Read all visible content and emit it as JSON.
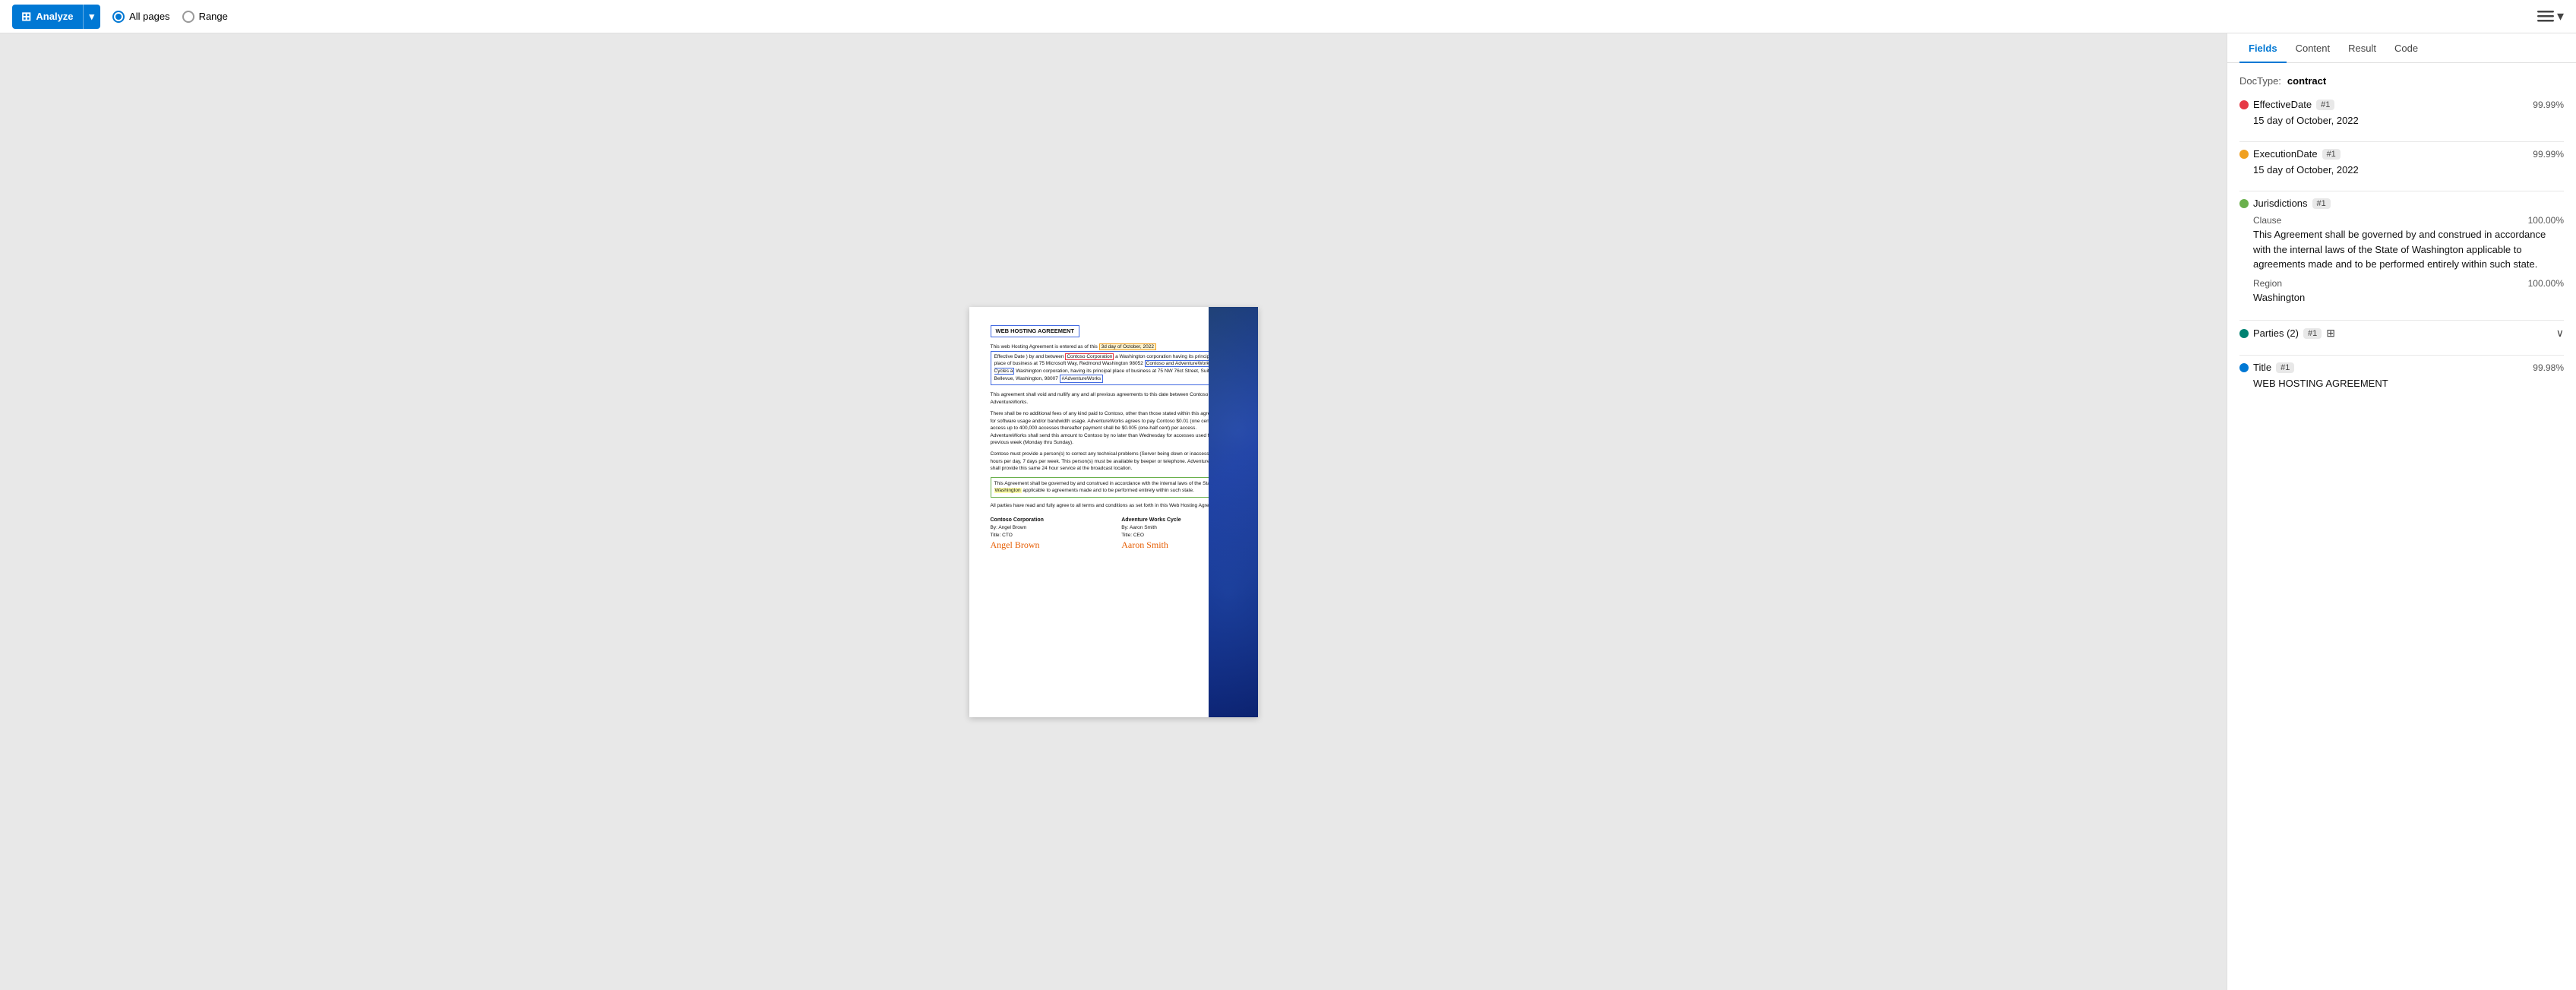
{
  "toolbar": {
    "analyze_label": "Analyze",
    "dropdown_icon": "▾",
    "all_pages_label": "All pages",
    "range_label": "Range",
    "layer_icon": "⊕"
  },
  "tabs": {
    "items": [
      "Fields",
      "Content",
      "Result",
      "Code"
    ],
    "active": "Fields"
  },
  "doctype": {
    "label": "DocType:",
    "value": "contract"
  },
  "fields": [
    {
      "id": "EffectiveDate",
      "name": "EffectiveDate",
      "badge": "#1",
      "dot_color": "dot-red",
      "confidence": "99.99%",
      "value": "15 day of October, 2022",
      "sub_fields": []
    },
    {
      "id": "ExecutionDate",
      "name": "ExecutionDate",
      "badge": "#1",
      "dot_color": "dot-orange",
      "confidence": "99.99%",
      "value": "15 day of October, 2022",
      "sub_fields": []
    },
    {
      "id": "Jurisdictions",
      "name": "Jurisdictions",
      "badge": "#1",
      "dot_color": "dot-green",
      "confidence": "",
      "value": "",
      "sub_fields": [
        {
          "label": "Clause",
          "confidence": "100.00%",
          "value": "This Agreement shall be governed by and construed in accordance with the internal laws of the State of Washington applicable to agreements made and to be performed entirely within such state."
        },
        {
          "label": "Region",
          "confidence": "100.00%",
          "value": "Washington"
        }
      ]
    },
    {
      "id": "Parties",
      "name": "Parties (2)",
      "badge": "#1",
      "dot_color": "dot-teal",
      "confidence": "",
      "value": "",
      "has_table": true,
      "has_chevron": true,
      "sub_fields": []
    },
    {
      "id": "Title",
      "name": "Title",
      "badge": "#1",
      "dot_color": "dot-blue",
      "confidence": "99.98%",
      "value": "WEB HOSTING AGREEMENT",
      "sub_fields": []
    }
  ],
  "document": {
    "title": "WEB HOSTING AGREEMENT",
    "intro": "This web Hosting Agreement is entered as of this 3d day of October, 2022 Effective Date ) by and between Contoso Corporation a Washington corporation having its principal place of business at 75 Microsoft Way, Redmond Washington 98052 Contoso and AdventureWorks Cycles a Washington corporation, having its principal place of business at 75 NW 76ct Street, Suite 54, Bellevue, Washington, 98007 AdventureWorks.",
    "para1": "This agreement shall void and nullify any and all previous agreements to this date between Contoso and AdventureWorks.",
    "para2": "There shall be no additional fees of any kind paid to Contoso, other than those stated within this agreement for software usage and/or bandwidth usage. AdventureWorks agrees to pay Contoso $0.01 (one cent) per access up to 400,000 accesses thereafter payment shall be $0.005 (one-half cent) per access. AdventureWorks shall send this amount to Contoso by no later than Wednesday for accesses used from the previous week (Monday thru Sunday).",
    "para3": "Contoso must provide a person(s) to correct any technical problems (Server being down or inaccessible) 24 hours per day, 7 days per week. This person(s) must be available by beeper or telephone. AdventureWorks shall provide this same 24 hour service at the broadcast location.",
    "para4": "This Agreement shall be governed by and construed in accordance with the internal laws of the State of Washington applicable to agreements made and to be performed entirely within such state.",
    "para5": "All parties have read and fully agree to all terms and conditions as set forth in this Web Hosting Agreement.",
    "sig_left_company": "Contoso Corporation",
    "sig_left_by": "By: Angel Brown",
    "sig_left_title": "Title: CTO",
    "sig_left_cursive": "Angel Brown",
    "sig_right_company": "Adventure Works Cycle",
    "sig_right_by": "By: Aaron Smith",
    "sig_right_title": "Title: CEO",
    "sig_right_cursive": "Aaron Smith"
  }
}
